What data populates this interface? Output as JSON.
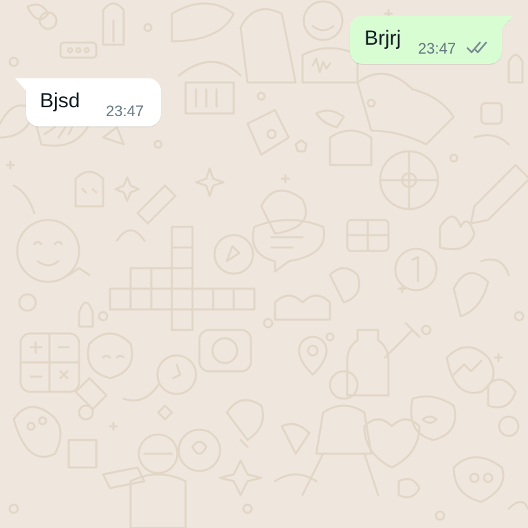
{
  "chat": {
    "messages": [
      {
        "direction": "outgoing",
        "text": "Brjrj",
        "time": "23:47",
        "status_icon": "double-check-icon"
      },
      {
        "direction": "incoming",
        "text": "Bjsd",
        "time": "23:47"
      }
    ]
  },
  "colors": {
    "wallpaper": "#efe7de",
    "wallpaper_doodle": "#e2d6c6",
    "outgoing_bubble": "#d9fdd3",
    "incoming_bubble": "#ffffff",
    "message_text": "#111b21",
    "timestamp": "#667781"
  }
}
